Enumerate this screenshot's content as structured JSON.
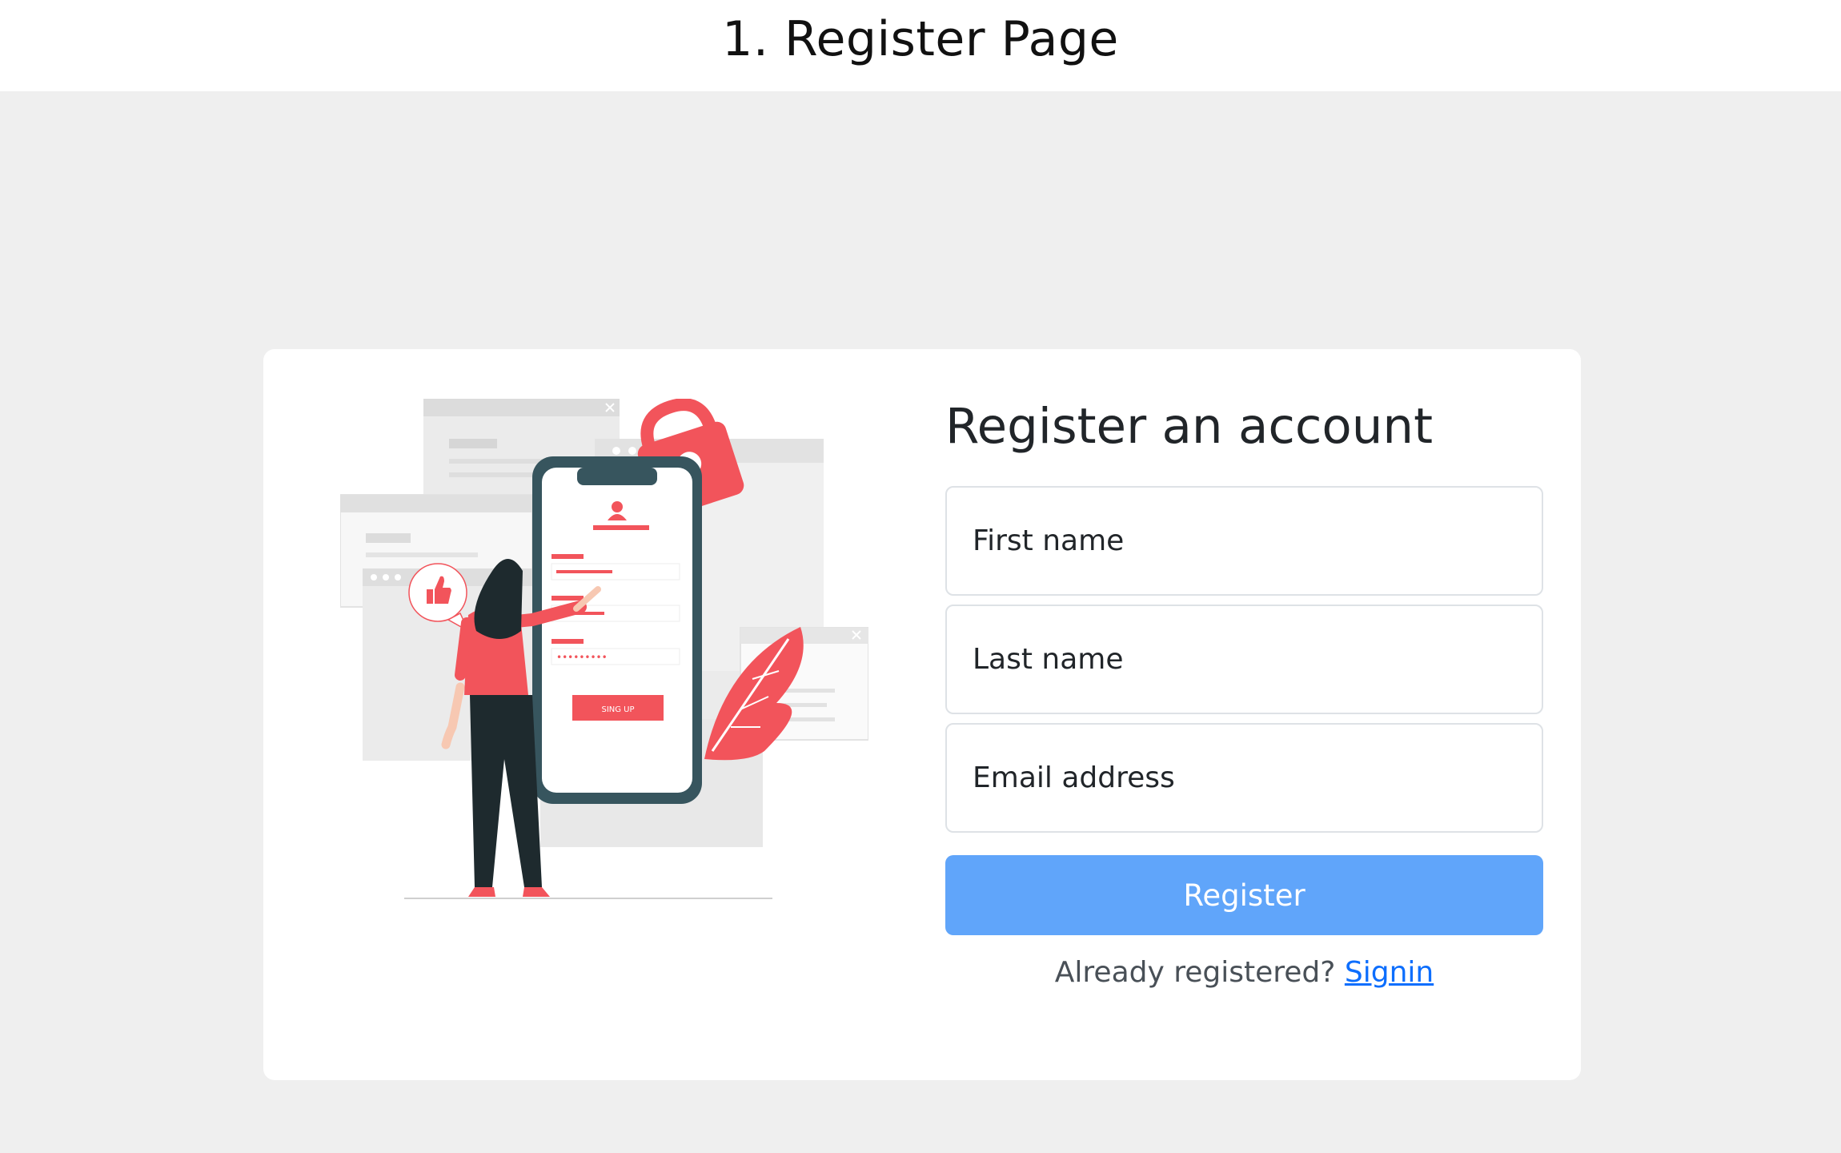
{
  "document": {
    "title": "1. Register Page"
  },
  "colors": {
    "canvas_bg": "#efefef",
    "card_bg": "#ffffff",
    "button_bg": "#60a5fa",
    "link": "#0d6efd",
    "illustration_accent": "#f2545b",
    "illustration_dark": "#263238"
  },
  "illustration": {
    "signup_button_label": "SING UP",
    "password_mask": "•••••••••",
    "icons": [
      "padlock-icon",
      "thumbs-up-icon",
      "user-icon",
      "close-icon",
      "leaf-icon"
    ]
  },
  "form": {
    "heading": "Register an account",
    "first_name_placeholder": "First name",
    "last_name_placeholder": "Last name",
    "email_placeholder": "Email address",
    "submit_label": "Register",
    "signin_prompt": "Already registered?",
    "signin_link": "Signin"
  }
}
